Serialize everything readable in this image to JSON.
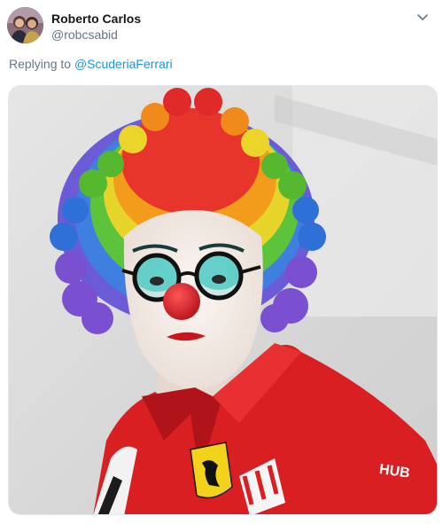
{
  "author": {
    "name": "Roberto Carlos",
    "handle": "@robcsabid",
    "avatar_icon": "profile-avatar"
  },
  "reply": {
    "prefix": "Replying to ",
    "mention": "@ScuderiaFerrari"
  },
  "media": {
    "icon": "clown-photo",
    "visible_text": "HUB",
    "colors": {
      "shirt": "#d91f22",
      "background": "#dcdcdc",
      "link": "#1b95e0"
    }
  },
  "menu": {
    "icon": "chevron-down-icon"
  }
}
